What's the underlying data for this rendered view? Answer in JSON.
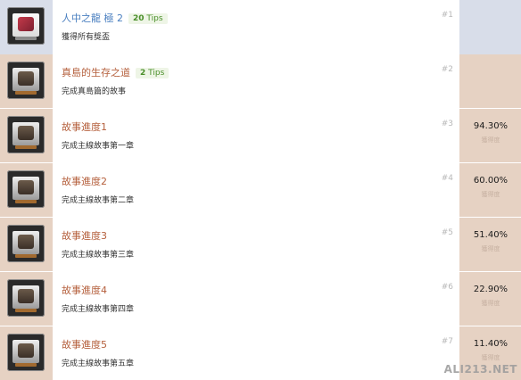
{
  "achievements": [
    {
      "title": "人中之龍 極 2",
      "tips_count": "20",
      "tips_label": "Tips",
      "description": "獲得所有獎盃",
      "number": "#1",
      "percent": "",
      "percent_label": "",
      "icon": "platinum-trophy-icon"
    },
    {
      "title": "真島的生存之道",
      "tips_count": "2",
      "tips_label": "Tips",
      "description": "完成真島篇的故事",
      "number": "#2",
      "percent": "",
      "percent_label": "",
      "icon": "trophy-icon"
    },
    {
      "title": "故事進度1",
      "tips_count": "",
      "tips_label": "",
      "description": "完成主線故事第一章",
      "number": "#3",
      "percent": "94.30%",
      "percent_label": "獲得度",
      "icon": "trophy-icon"
    },
    {
      "title": "故事進度2",
      "tips_count": "",
      "tips_label": "",
      "description": "完成主線故事第二章",
      "number": "#4",
      "percent": "60.00%",
      "percent_label": "獲得度",
      "icon": "trophy-icon"
    },
    {
      "title": "故事進度3",
      "tips_count": "",
      "tips_label": "",
      "description": "完成主線故事第三章",
      "number": "#5",
      "percent": "51.40%",
      "percent_label": "獲得度",
      "icon": "trophy-icon"
    },
    {
      "title": "故事進度4",
      "tips_count": "",
      "tips_label": "",
      "description": "完成主線故事第四章",
      "number": "#6",
      "percent": "22.90%",
      "percent_label": "獲得度",
      "icon": "trophy-icon"
    },
    {
      "title": "故事進度5",
      "tips_count": "",
      "tips_label": "",
      "description": "完成主線故事第五章",
      "number": "#7",
      "percent": "11.40%",
      "percent_label": "獲得度",
      "icon": "trophy-icon"
    }
  ],
  "watermark": "ALI213.NET",
  "colors": {
    "accent_blue": "#4a7fc0",
    "accent_orange": "#b5603d",
    "tips_green": "#4a8f2a",
    "strip_blue": "#d8dde9",
    "strip_tan": "#e6d2c3"
  }
}
